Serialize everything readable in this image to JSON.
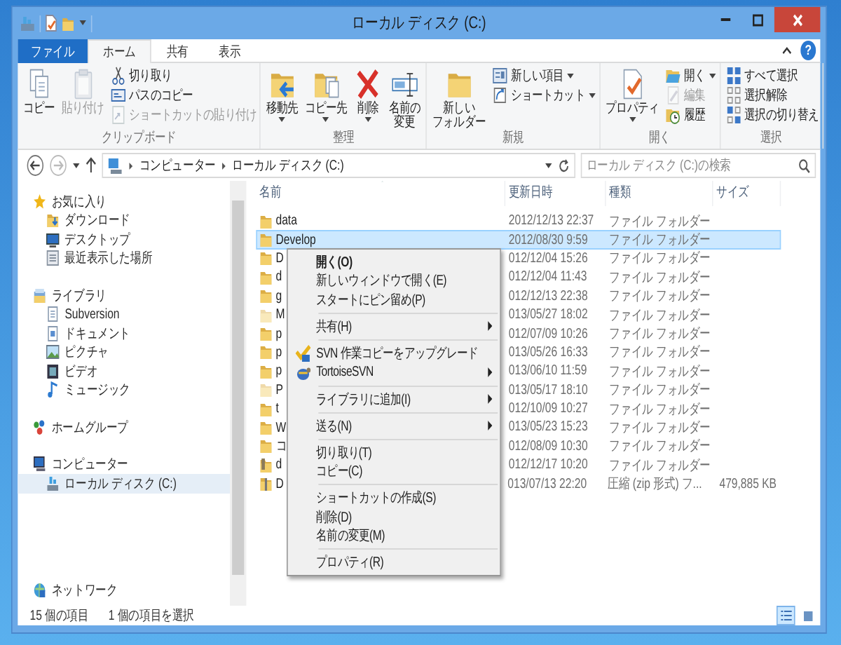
{
  "window": {
    "title": "ローカル ディスク (C:)"
  },
  "ribbon_tabs": [
    {
      "label": "ファイル",
      "kind": "file",
      "selected": false
    },
    {
      "label": "ホーム",
      "kind": "tab",
      "selected": true
    },
    {
      "label": "共有",
      "kind": "tab",
      "selected": false
    },
    {
      "label": "表示",
      "kind": "tab",
      "selected": false
    }
  ],
  "help_button": "?",
  "ribbon": {
    "groups": [
      {
        "label": "クリップボード",
        "large": [
          {
            "lines": [
              "コピー"
            ],
            "dropdown": false,
            "disabled": false
          },
          {
            "lines": [
              "貼り付け"
            ],
            "dropdown": false,
            "disabled": true
          }
        ],
        "small": [
          {
            "label": "切り取り",
            "dropdown": false,
            "disabled": false
          },
          {
            "label": "パスのコピー",
            "dropdown": false,
            "disabled": false
          },
          {
            "label": "ショートカットの貼り付け",
            "dropdown": false,
            "disabled": true
          }
        ]
      },
      {
        "label": "整理",
        "large": [
          {
            "lines": [
              "移動先"
            ],
            "dropdown": true,
            "disabled": false
          },
          {
            "lines": [
              "コピー先"
            ],
            "dropdown": true,
            "disabled": false
          },
          {
            "lines": [
              "削除"
            ],
            "dropdown": true,
            "disabled": false
          },
          {
            "lines": [
              "名前の",
              "変更"
            ],
            "dropdown": false,
            "disabled": false
          }
        ]
      },
      {
        "label": "新規",
        "large": [
          {
            "lines": [
              "新しい",
              "フォルダー"
            ],
            "dropdown": false,
            "disabled": false
          }
        ],
        "small": [
          {
            "label": "新しい項目",
            "dropdown": true,
            "disabled": false
          },
          {
            "label": "ショートカット",
            "dropdown": true,
            "disabled": false
          }
        ]
      },
      {
        "label": "開く",
        "large": [
          {
            "lines": [
              "プロパティ"
            ],
            "dropdown": true,
            "disabled": false
          }
        ],
        "small": [
          {
            "label": "開く",
            "dropdown": true,
            "disabled": false
          },
          {
            "label": "編集",
            "dropdown": false,
            "disabled": true
          },
          {
            "label": "履歴",
            "dropdown": false,
            "disabled": false
          }
        ]
      },
      {
        "label": "選択",
        "small": [
          {
            "label": "すべて選択",
            "dropdown": false,
            "disabled": false
          },
          {
            "label": "選択解除",
            "dropdown": false,
            "disabled": false
          },
          {
            "label": "選択の切り替え",
            "dropdown": false,
            "disabled": false
          }
        ]
      }
    ]
  },
  "address_bar": {
    "path": [
      "コンピューター",
      "ローカル ディスク (C:)"
    ]
  },
  "search": {
    "placeholder": "ローカル ディスク (C:)の検索"
  },
  "navigation": {
    "sections": [
      {
        "label": "お気に入り",
        "selected": false,
        "children": [
          {
            "label": "ダウンロード",
            "selected": false
          },
          {
            "label": "デスクトップ",
            "selected": false
          },
          {
            "label": "最近表示した場所",
            "selected": false
          }
        ]
      },
      {
        "label": "ライブラリ",
        "selected": false,
        "children": [
          {
            "label": "Subversion",
            "selected": false
          },
          {
            "label": "ドキュメント",
            "selected": false
          },
          {
            "label": "ピクチャ",
            "selected": false
          },
          {
            "label": "ビデオ",
            "selected": false
          },
          {
            "label": "ミュージック",
            "selected": false
          }
        ]
      },
      {
        "label": "ホームグループ",
        "selected": false
      },
      {
        "label": "コンピューター",
        "selected": false,
        "children": [
          {
            "label": "ローカル ディスク (C:)",
            "selected": true
          }
        ]
      },
      {
        "label": "ネットワーク",
        "selected": false
      }
    ]
  },
  "file_list": {
    "columns": [
      "名前",
      "更新日時",
      "種類",
      "サイズ"
    ],
    "rows": [
      {
        "kind": "folder",
        "name": "data",
        "modified": "2012/12/13 22:37",
        "type": "ファイル フォルダー",
        "selected": false
      },
      {
        "kind": "folder",
        "name": "Develop",
        "modified": "2012/08/30 9:59",
        "type": "ファイル フォルダー",
        "selected": true
      },
      {
        "kind": "folder",
        "name": "D",
        "modified": "012/12/04 15:26",
        "type": "ファイル フォルダー",
        "selected": false
      },
      {
        "kind": "folder",
        "name": "d",
        "modified": "012/12/04 11:43",
        "type": "ファイル フォルダー",
        "selected": false
      },
      {
        "kind": "folder",
        "name": "g",
        "modified": "012/12/13 22:38",
        "type": "ファイル フォルダー",
        "selected": false
      },
      {
        "kind": "hidden",
        "name": "M",
        "modified": "013/05/27 18:02",
        "type": "ファイル フォルダー",
        "selected": false
      },
      {
        "kind": "folder",
        "name": "p",
        "modified": "012/07/09 10:26",
        "type": "ファイル フォルダー",
        "selected": false
      },
      {
        "kind": "folder",
        "name": "p",
        "modified": "013/05/26 16:33",
        "type": "ファイル フォルダー",
        "selected": false
      },
      {
        "kind": "folder",
        "name": "p",
        "modified": "013/06/10 11:59",
        "type": "ファイル フォルダー",
        "selected": false
      },
      {
        "kind": "hidden",
        "name": "P",
        "modified": "013/05/17 18:10",
        "type": "ファイル フォルダー",
        "selected": false
      },
      {
        "kind": "folder",
        "name": "t",
        "modified": "012/10/09 10:27",
        "type": "ファイル フォルダー",
        "selected": false
      },
      {
        "kind": "folder",
        "name": "W",
        "modified": "013/05/23 15:23",
        "type": "ファイル フォルダー",
        "selected": false
      },
      {
        "kind": "folder",
        "name": "コ",
        "modified": "012/08/09 10:30",
        "type": "ファイル フォルダー",
        "selected": false
      },
      {
        "kind": "special",
        "name": "d",
        "modified": "012/12/17 10:20",
        "type": "ファイル フォルダー",
        "selected": false
      },
      {
        "kind": "zip",
        "name": "D",
        "modified": "013/07/13 22:20",
        "type": "圧縮 (zip 形式) フ...",
        "size": "479,885 KB",
        "selected": false
      }
    ]
  },
  "context_menu": {
    "items": [
      {
        "kind": "bold",
        "label": "開く(O)",
        "submenu": false
      },
      {
        "kind": "plain",
        "label": "新しいウィンドウで開く(E)",
        "submenu": false
      },
      {
        "kind": "plain",
        "label": "スタートにピン留め(P)",
        "submenu": false
      },
      {
        "kind": "separator"
      },
      {
        "kind": "plain",
        "label": "共有(H)",
        "submenu": true
      },
      {
        "kind": "separator"
      },
      {
        "kind": "upgrade",
        "label": "SVN 作業コピーをアップグレード",
        "submenu": false
      },
      {
        "kind": "tortoise",
        "label": "TortoiseSVN",
        "submenu": true
      },
      {
        "kind": "separator"
      },
      {
        "kind": "plain",
        "label": "ライブラリに追加(I)",
        "submenu": true
      },
      {
        "kind": "separator"
      },
      {
        "kind": "plain",
        "label": "送る(N)",
        "submenu": true
      },
      {
        "kind": "separator"
      },
      {
        "kind": "plain",
        "label": "切り取り(T)",
        "submenu": false
      },
      {
        "kind": "plain",
        "label": "コピー(C)",
        "submenu": false
      },
      {
        "kind": "separator"
      },
      {
        "kind": "plain",
        "label": "ショートカットの作成(S)",
        "submenu": false
      },
      {
        "kind": "plain",
        "label": "削除(D)",
        "submenu": false
      },
      {
        "kind": "plain",
        "label": "名前の変更(M)",
        "submenu": false
      },
      {
        "kind": "separator"
      },
      {
        "kind": "plain",
        "label": "プロパティ(R)",
        "submenu": false
      }
    ]
  },
  "status_bar": {
    "item_count": "15 個の項目",
    "selection": "1 個の項目を選択"
  },
  "view_buttons": [
    {
      "kind": "details",
      "selected": true
    },
    {
      "kind": "large-icons",
      "selected": false
    }
  ]
}
